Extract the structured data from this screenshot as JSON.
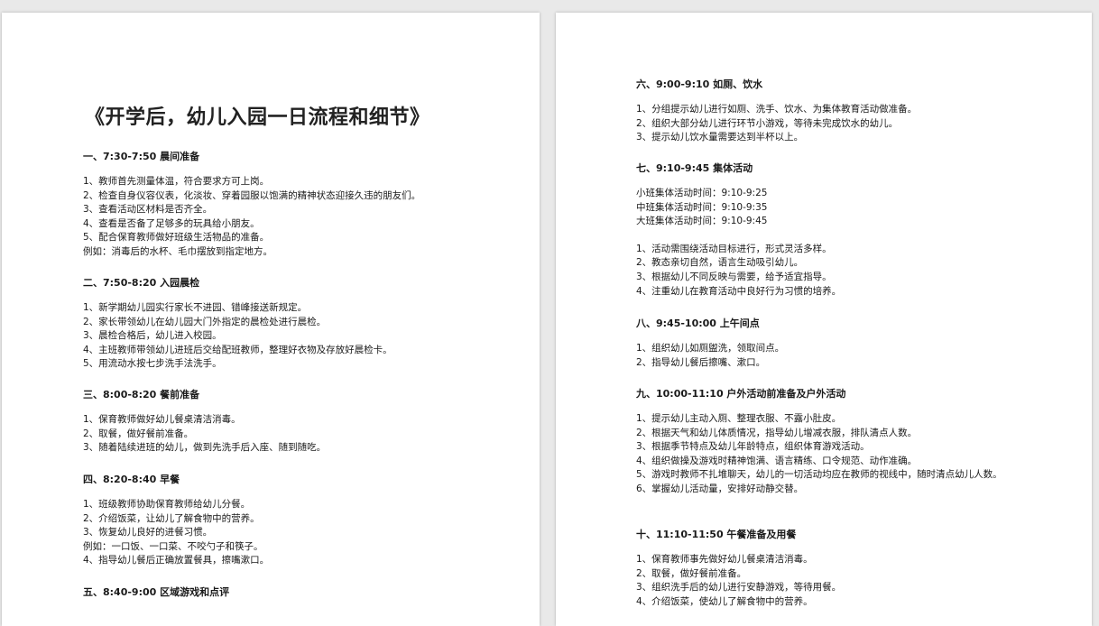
{
  "left_page": {
    "title": "《开学后，幼儿入园一日流程和细节》",
    "sections": [
      {
        "heading": "一、7:30-7:50 晨间准备",
        "lines": [
          "1、教师首先测量体温，符合要求方可上岗。",
          "2、检查自身仪容仪表，化淡妆、穿着园服以饱满的精神状态迎接久违的朋友们。",
          "3、查看活动区材料是否齐全。",
          "4、查看是否备了足够多的玩具给小朋友。",
          "5、配合保育教师做好班级生活物品的准备。",
          "例如：消毒后的水杯、毛巾摆放到指定地方。"
        ]
      },
      {
        "heading": "二、7:50-8:20 入园晨检",
        "lines": [
          "1、新学期幼儿园实行家长不进园、错峰接送新规定。",
          "2、家长带领幼儿在幼儿园大门外指定的晨检处进行晨检。",
          "3、晨检合格后，幼儿进入校园。",
          "4、主班教师带领幼儿进班后交给配班教师，整理好衣物及存放好晨检卡。",
          "5、用流动水按七步洗手法洗手。"
        ]
      },
      {
        "heading": "三、8:00-8:20 餐前准备",
        "lines": [
          "1、保育教师做好幼儿餐桌清洁消毒。",
          "2、取餐，做好餐前准备。",
          "3、随着陆续进班的幼儿，做到先洗手后入座、随到随吃。"
        ]
      },
      {
        "heading": "四、8:20-8:40 早餐",
        "lines": [
          "1、班级教师协助保育教师给幼儿分餐。",
          "2、介绍饭菜，让幼儿了解食物中的营养。",
          "3、恢复幼儿良好的进餐习惯。",
          "例如：一口饭、一口菜、不咬勺子和筷子。",
          "4、指导幼儿餐后正确放置餐具，擦嘴漱口。"
        ]
      },
      {
        "heading": "五、8:40-9:00 区域游戏和点评",
        "lines": []
      }
    ]
  },
  "right_page": {
    "sections": [
      {
        "heading": "六、9:00-9:10 如厕、饮水",
        "lines": [
          "1、分组提示幼儿进行如厕、洗手、饮水、为集体教育活动做准备。",
          "2、组织大部分幼儿进行环节小游戏，等待未完成饮水的幼儿。",
          "3、提示幼儿饮水量需要达到半杯以上。"
        ]
      },
      {
        "heading": "七、9:10-9:45 集体活动",
        "lines": [
          "小班集体活动时间：9:10-9:25",
          "中班集体活动时间：9:10-9:35",
          "大班集体活动时间：9:10-9:45"
        ],
        "lines2": [
          "1、活动需围绕活动目标进行，形式灵活多样。",
          "2、教态亲切自然，语言生动吸引幼儿。",
          "3、根据幼儿不同反映与需要，给予适宜指导。",
          "4、注重幼儿在教育活动中良好行为习惯的培养。"
        ]
      },
      {
        "heading": "八、9:45-10:00 上午间点",
        "lines": [
          "1、组织幼儿如厕盥洗，领取间点。",
          "2、指导幼儿餐后擦嘴、漱口。"
        ]
      },
      {
        "heading": "九、10:00-11:10 户外活动前准备及户外活动",
        "lines": [
          "1、提示幼儿主动入厕、整理衣服、不露小肚皮。",
          "2、根据天气和幼儿体质情况，指导幼儿增减衣服，排队清点人数。",
          "3、根据季节特点及幼儿年龄特点，组织体育游戏活动。",
          "4、组织做操及游戏时精神饱满、语言精练、口令规范、动作准确。",
          "5、游戏时教师不扎堆聊天，幼儿的一切活动均应在教师的视线中，随时清点幼儿人数。",
          "6、掌握幼儿活动量，安排好动静交替。"
        ]
      },
      {
        "heading": "十、11:10-11:50 午餐准备及用餐",
        "lines": [
          "1、保育教师事先做好幼儿餐桌清洁消毒。",
          "2、取餐，做好餐前准备。",
          "3、组织洗手后的幼儿进行安静游戏，等待用餐。",
          "4、介绍饭菜，使幼儿了解食物中的营养。"
        ]
      }
    ]
  }
}
